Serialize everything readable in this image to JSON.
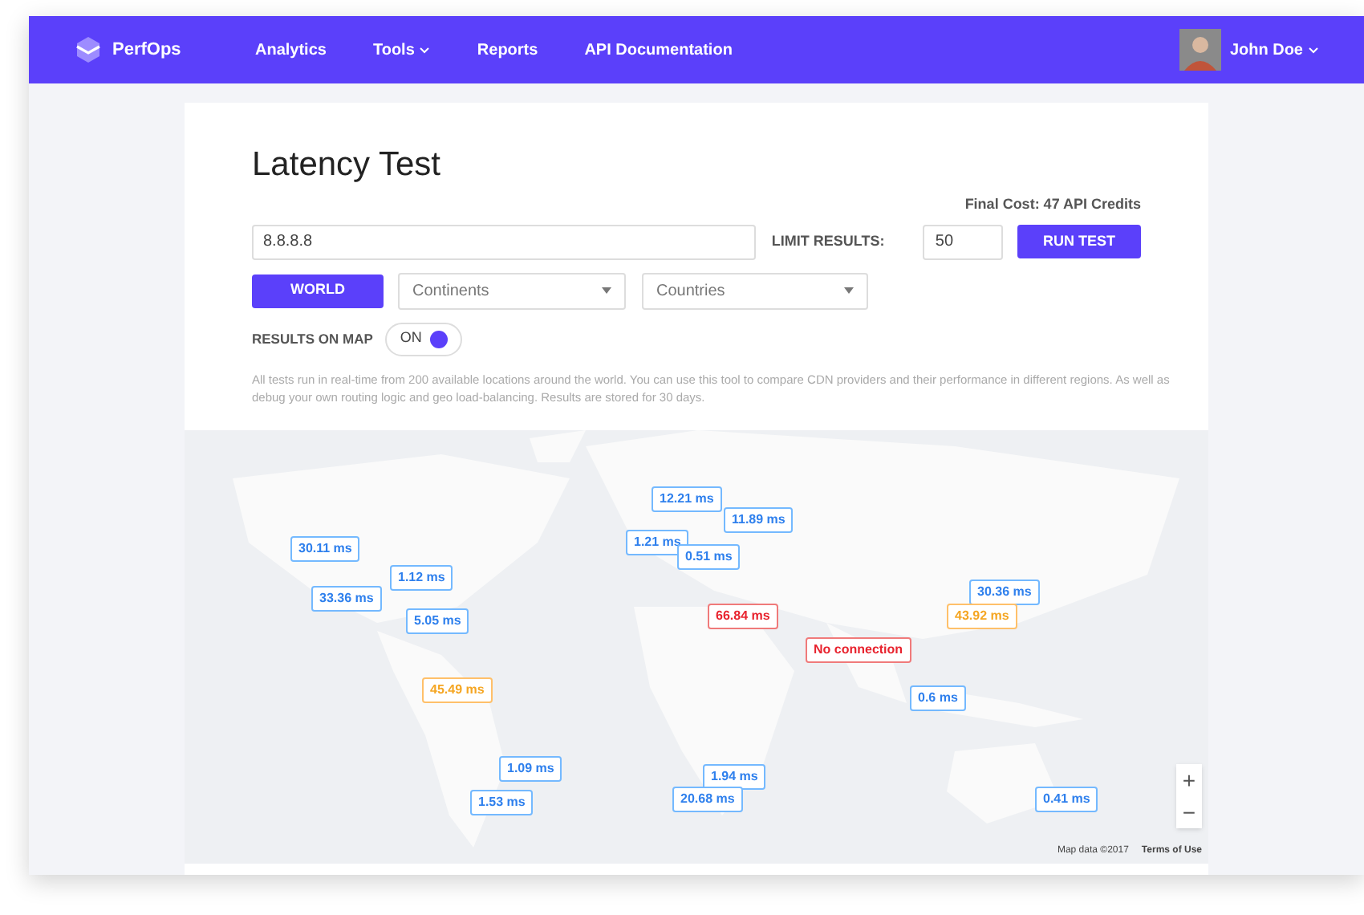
{
  "navbar": {
    "brand": "PerfOps",
    "links": [
      {
        "label": "Analytics",
        "dropdown": false
      },
      {
        "label": "Tools",
        "dropdown": true
      },
      {
        "label": "Reports",
        "dropdown": false
      },
      {
        "label": "API Documentation",
        "dropdown": false
      }
    ],
    "user": {
      "name": "John Doe"
    }
  },
  "page": {
    "title": "Latency Test",
    "cost": "Final Cost: 47 API Credits",
    "target": {
      "value": "8.8.8.8"
    },
    "limit_label": "LIMIT RESULTS:",
    "limit": {
      "value": "50"
    },
    "run_button": "RUN TEST",
    "scope_buttons": [
      {
        "label": "WORLD",
        "selected": true
      }
    ],
    "selects": [
      {
        "placeholder": "Continents"
      },
      {
        "placeholder": "Countries"
      }
    ],
    "map_toggle": {
      "label": "RESULTS ON MAP",
      "state_text": "ON",
      "on": true
    },
    "description": "All tests run in real-time from 200 available locations around the world. You can use this tool to compare CDN providers and their performance in different regions. As well as debug your own routing logic and geo load-balancing. Results are stored for 30 days."
  },
  "map": {
    "markers": [
      {
        "text": "30.11 ms",
        "color": "#74b9ff"
      },
      {
        "text": "1.12 ms",
        "color": "#74b9ff"
      },
      {
        "text": "33.36 ms",
        "color": "#74b9ff"
      },
      {
        "text": "5.05 ms",
        "color": "#74b9ff"
      },
      {
        "text": "45.49 ms",
        "color": "#ffc06a"
      },
      {
        "text": "1.09 ms",
        "color": "#74b9ff"
      },
      {
        "text": "1.53 ms",
        "color": "#74b9ff"
      },
      {
        "text": "12.21 ms",
        "color": "#74b9ff"
      },
      {
        "text": "11.89 ms",
        "color": "#74b9ff"
      },
      {
        "text": "1.21 ms",
        "color": "#74b9ff"
      },
      {
        "text": "0.51 ms",
        "color": "#74b9ff"
      },
      {
        "text": "66.84 ms",
        "color": "#f07a7a"
      },
      {
        "text": "No connection",
        "color": "#f07a7a"
      },
      {
        "text": "30.36 ms",
        "color": "#74b9ff"
      },
      {
        "text": "43.92 ms",
        "color": "#ffc06a"
      },
      {
        "text": "0.6 ms",
        "color": "#74b9ff"
      },
      {
        "text": "1.94 ms",
        "color": "#74b9ff"
      },
      {
        "text": "20.68 ms",
        "color": "#74b9ff"
      },
      {
        "text": "0.41 ms",
        "color": "#74b9ff"
      }
    ],
    "zoom_in": "+",
    "zoom_out": "−",
    "attribution": "Map data ©2017",
    "terms": "Terms of Use"
  }
}
